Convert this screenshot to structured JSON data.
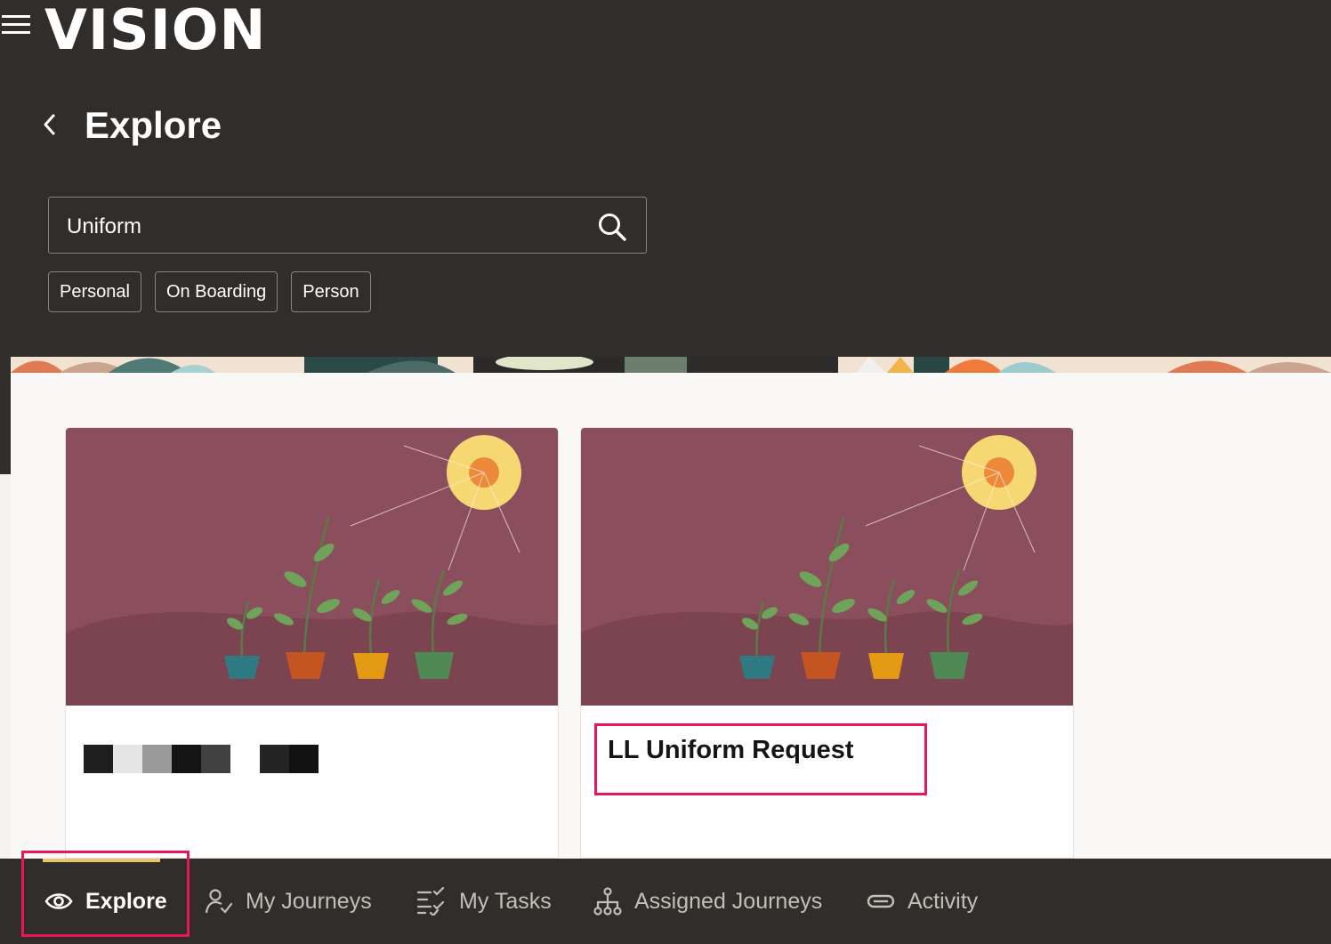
{
  "header": {
    "logo": "VISION",
    "menu_icon": "hamburger-menu-icon"
  },
  "page": {
    "title": "Explore",
    "back_icon": "chevron-left-icon"
  },
  "search": {
    "value": "Uniform",
    "icon": "search-icon"
  },
  "filters": [
    "Personal",
    "On Boarding",
    "Person"
  ],
  "cards": [
    {
      "title": "",
      "title_redacted": true
    },
    {
      "title": "LL Uniform Request"
    }
  ],
  "bottom_nav": [
    {
      "label": "Explore",
      "icon": "eye-icon",
      "active": true
    },
    {
      "label": "My Journeys",
      "icon": "person-check-icon"
    },
    {
      "label": "My Tasks",
      "icon": "checklist-icon"
    },
    {
      "label": "Assigned Journeys",
      "icon": "hierarchy-icon"
    },
    {
      "label": "Activity",
      "icon": "pill-icon"
    }
  ],
  "colors": {
    "background": "#312d2a",
    "card_art": "#8a4e5c",
    "highlight": "#e8175d",
    "active_bar": "#e8c46a"
  }
}
